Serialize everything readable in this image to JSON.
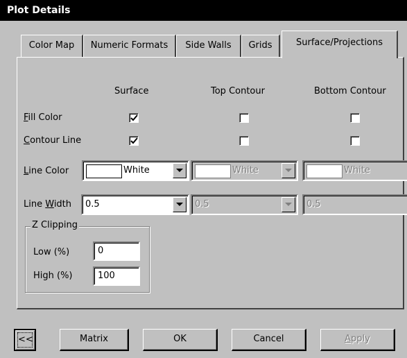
{
  "window": {
    "title": "Plot Details"
  },
  "tabs": [
    {
      "label": "Color Map"
    },
    {
      "label": "Numeric Formats"
    },
    {
      "label": "Side Walls"
    },
    {
      "label": "Grids"
    },
    {
      "label": "Surface/Projections",
      "active": true
    }
  ],
  "columns": {
    "surface": "Surface",
    "top": "Top Contour",
    "bottom": "Bottom Contour"
  },
  "rows": {
    "fill_color": {
      "access_key": "F",
      "label_rest": "ill Color",
      "surface": true,
      "top": false,
      "bottom": false
    },
    "contour_line": {
      "access_key": "C",
      "label_rest": "ontour Line",
      "surface": true,
      "top": false,
      "bottom": false
    }
  },
  "line_color": {
    "label_key": "L",
    "label_rest": "ine Color",
    "surface": "White",
    "top": "White",
    "bottom": "White",
    "swatch_color": "#ffffff"
  },
  "line_width": {
    "label_pre": "Line ",
    "label_key": "W",
    "label_rest": "idth",
    "surface": "0.5",
    "top": "0.5",
    "bottom": "0.5"
  },
  "z_clipping": {
    "title": "Z Clipping",
    "low_label": "Low (%)",
    "low_value": "0",
    "high_label": "High (%)",
    "high_value": "100"
  },
  "buttons": {
    "collapse": "<<",
    "matrix": "Matrix",
    "ok": "OK",
    "cancel": "Cancel",
    "apply_key": "A",
    "apply_rest": "pply"
  }
}
